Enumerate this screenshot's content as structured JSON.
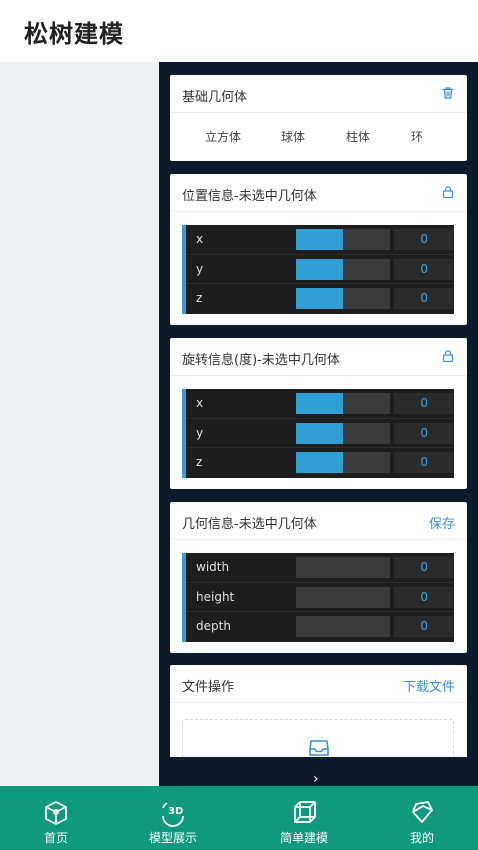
{
  "app": {
    "title": "松树建模"
  },
  "basic_shapes": {
    "title": "基础几何体",
    "icon": "trash-icon",
    "items": [
      "立方体",
      "球体",
      "柱体",
      "环"
    ]
  },
  "position": {
    "title": "位置信息-未选中几何体",
    "icon": "lock-icon",
    "rows": [
      {
        "label": "x",
        "value": "0",
        "fill_fraction": 0.5
      },
      {
        "label": "y",
        "value": "0",
        "fill_fraction": 0.5
      },
      {
        "label": "z",
        "value": "0",
        "fill_fraction": 0.5
      }
    ]
  },
  "rotation": {
    "title": "旋转信息(度)-未选中几何体",
    "icon": "lock-icon",
    "rows": [
      {
        "label": "x",
        "value": "0",
        "fill_fraction": 0.5
      },
      {
        "label": "y",
        "value": "0",
        "fill_fraction": 0.5
      },
      {
        "label": "z",
        "value": "0",
        "fill_fraction": 0.5
      }
    ]
  },
  "geometry": {
    "title": "几何信息-未选中几何体",
    "action": "保存",
    "rows": [
      {
        "label": "width",
        "value": "0",
        "fill_fraction": 0
      },
      {
        "label": "height",
        "value": "0",
        "fill_fraction": 0
      },
      {
        "label": "depth",
        "value": "0",
        "fill_fraction": 0
      }
    ]
  },
  "file_ops": {
    "title": "文件操作",
    "action": "下载文件",
    "icon": "inbox-icon"
  },
  "collapse": {
    "arrow": "›"
  },
  "tabs": [
    {
      "label": "首页",
      "icon": "home-icon"
    },
    {
      "label": "模型展示",
      "icon": "3d-rotate-icon"
    },
    {
      "label": "简单建模",
      "icon": "cube-icon"
    },
    {
      "label": "我的",
      "icon": "user-icon"
    }
  ],
  "colors": {
    "accent": "#2f9fd6",
    "link": "#3a8ee6",
    "tabbar": "#0f9a7e",
    "panel_bg": "#0c1a2b"
  }
}
